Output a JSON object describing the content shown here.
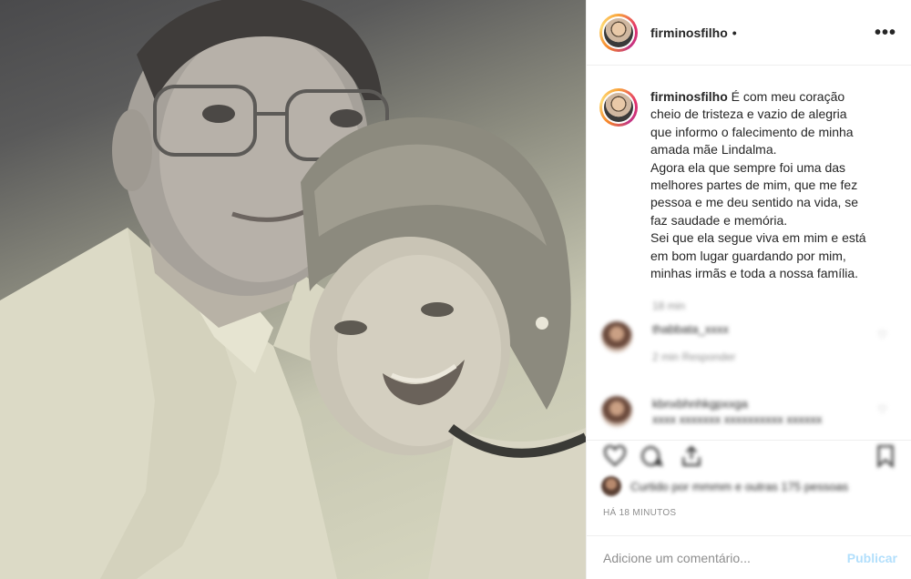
{
  "post": {
    "username": "firminosfilho",
    "header_separator": "•",
    "more_icon": "more-icon",
    "caption_lines": [
      "É com meu coração",
      "cheio de tristeza e vazio de alegria",
      "que informo o falecimento de minha",
      "amada mãe Lindalma.",
      "Agora ela que sempre foi uma das",
      "melhores partes de mim, que me fez",
      "pessoa e me deu sentido na vida, se",
      "faz saudade e memória.",
      "Sei que ela segue viva em mim e está",
      "em bom lugar guardando por mim,",
      "minhas irmãs e toda a nossa família."
    ],
    "caption_time": "18 min",
    "comments": [
      {
        "user": "thabbata_xxxx",
        "text": "",
        "meta": "2 min    Responder"
      },
      {
        "user": "kbnxbhnhkgpxxga",
        "text": "xxxx xxxxxxx xxxxxxxxxx xxxxxx",
        "meta": ""
      }
    ],
    "likes_text": "Curtido por mmmm e outras 175 pessoas",
    "time_ago": "HÁ 18 MINUTOS",
    "comment_placeholder": "Adicione um comentário...",
    "publish_label": "Publicar"
  },
  "colors": {
    "accent_disabled": "#b2dffc",
    "muted": "#8e8e8e",
    "text": "#262626",
    "border": "#efefef"
  }
}
